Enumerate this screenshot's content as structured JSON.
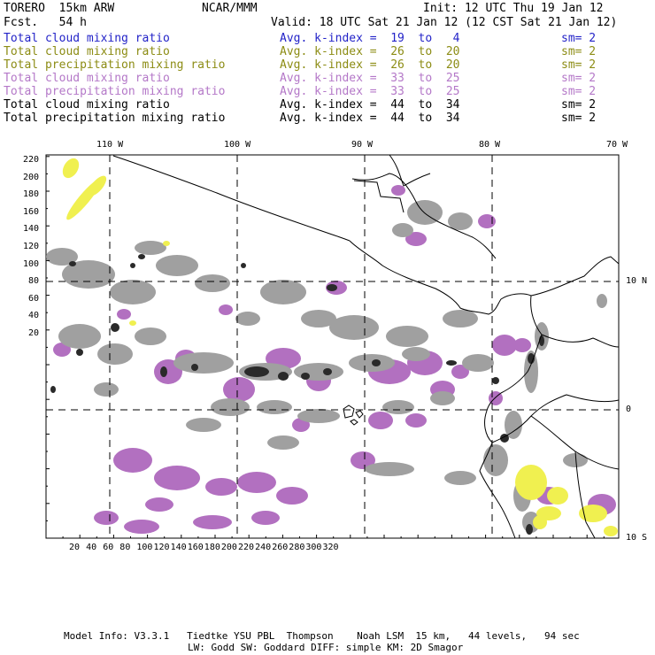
{
  "header": {
    "model": "TORERO  15km ARW",
    "org": "NCAR/MMM",
    "init": "Init: 12 UTC Thu 19 Jan 12",
    "fcst": "Fcst.   54 h",
    "valid": "Valid: 18 UTC Sat 21 Jan 12 (12 CST Sat 21 Jan 12)"
  },
  "legend": [
    {
      "field": "Total cloud mixing ratio",
      "kindex": "Avg. k-index =  19  to   4",
      "sm": "sm= 2",
      "color": "#2323c8"
    },
    {
      "field": "Total cloud mixing ratio",
      "kindex": "Avg. k-index =  26  to  20",
      "sm": "sm= 2",
      "color": "#8c8c14"
    },
    {
      "field": "Total precipitation mixing ratio",
      "kindex": "Avg. k-index =  26  to  20",
      "sm": "sm= 2",
      "color": "#8c8c14"
    },
    {
      "field": "Total cloud mixing ratio",
      "kindex": "Avg. k-index =  33  to  25",
      "sm": "sm= 2",
      "color": "#b478c8"
    },
    {
      "field": "Total precipitation mixing ratio",
      "kindex": "Avg. k-index =  33  to  25",
      "sm": "sm= 2",
      "color": "#b478c8"
    },
    {
      "field": "Total cloud mixing ratio",
      "kindex": "Avg. k-index =  44  to  34",
      "sm": "sm= 2",
      "color": "#000000"
    },
    {
      "field": "Total precipitation mixing ratio",
      "kindex": "Avg. k-index =  44  to  34",
      "sm": "sm= 2",
      "color": "#000000"
    }
  ],
  "axes": {
    "top_lon": [
      "110 W",
      "100 W",
      "90 W",
      "80 W",
      "70 W"
    ],
    "right_lat": [
      "10 N",
      "0",
      "10 S"
    ],
    "left_y": [
      "220",
      "200",
      "180",
      "160",
      "140",
      "120",
      "100",
      "80",
      "60",
      "40",
      "20"
    ],
    "bottom_x": [
      "20",
      "40",
      "60",
      "80",
      "100",
      "120",
      "140",
      "160",
      "180",
      "200",
      "220",
      "240",
      "260",
      "280",
      "300",
      "320"
    ]
  },
  "colors": {
    "gray": "#a0a0a0",
    "purple": "#b270c0",
    "yellow": "#f0f050",
    "dark": "#2a2a2a"
  },
  "footer": {
    "line1": "Model Info: V3.3.1   Tiedtke YSU PBL  Thompson    Noah LSM  15 km,   44 levels,   94 sec",
    "line2": "LW: Godd SW: Goddard DIFF: simple KM: 2D Smagor"
  }
}
